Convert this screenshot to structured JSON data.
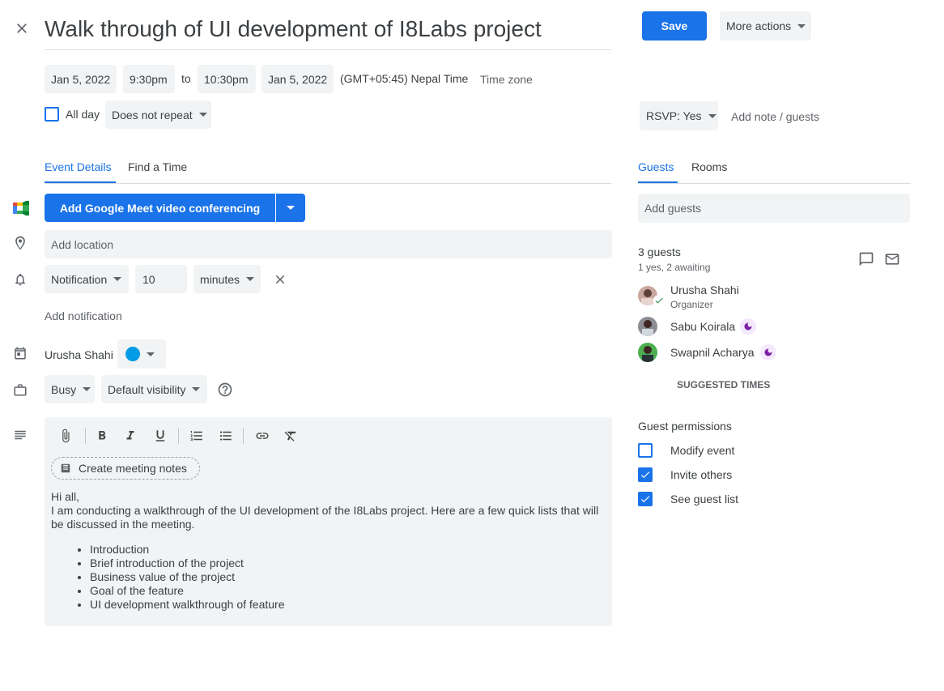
{
  "header": {
    "close_label": "×",
    "title": "Walk through of UI development of I8Labs project",
    "save_label": "Save",
    "more_actions_label": "More actions"
  },
  "datetime": {
    "start_date": "Jan 5, 2022",
    "start_time": "9:30pm",
    "to_label": "to",
    "end_time": "10:30pm",
    "end_date": "Jan 5, 2022",
    "timezone_text": "(GMT+05:45) Nepal Time",
    "timezone_link": "Time zone",
    "all_day_label": "All day",
    "repeat_value": "Does not repeat"
  },
  "rsvp": {
    "value": "RSVP: Yes",
    "add_note_label": "Add note / guests"
  },
  "left_tabs": [
    {
      "label": "Event Details"
    },
    {
      "label": "Find a Time"
    }
  ],
  "right_tabs": [
    {
      "label": "Guests"
    },
    {
      "label": "Rooms"
    }
  ],
  "event": {
    "meet_button_label": "Add Google Meet video conferencing",
    "location_placeholder": "Add location",
    "notification": {
      "type": "Notification",
      "amount": "10",
      "unit": "minutes",
      "add_label": "Add notification"
    },
    "calendar_owner": "Urusha Shahi",
    "calendar_color": "#039be5",
    "busy_value": "Busy",
    "visibility_value": "Default visibility",
    "create_notes_label": "Create meeting notes",
    "description": {
      "line1": "Hi all,",
      "line2": "I am conducting a walkthrough of the UI development of the I8Labs project. Here are a few quick lists that will be discussed in the meeting.",
      "items": [
        "Introduction",
        "Brief introduction of the project",
        "Business value of the project",
        "Goal of the feature",
        "UI development walkthrough of feature"
      ]
    }
  },
  "guests": {
    "add_placeholder": "Add guests",
    "count_label": "3 guests",
    "status_label": "1 yes, 2 awaiting",
    "list": [
      {
        "name": "Urusha Shahi",
        "role": "Organizer"
      },
      {
        "name": "Sabu Koirala",
        "role": ""
      },
      {
        "name": "Swapnil Acharya",
        "role": ""
      }
    ],
    "suggested_times_label": "SUGGESTED TIMES",
    "permissions_title": "Guest permissions",
    "permissions": [
      {
        "label": "Modify event",
        "checked": false
      },
      {
        "label": "Invite others",
        "checked": true
      },
      {
        "label": "See guest list",
        "checked": true
      }
    ]
  },
  "colors": {
    "accent": "#1a73e8",
    "chip_bg": "#f1f3f4",
    "text": "#3c4043",
    "moon_purple": "#7b1fa2"
  },
  "icons": {
    "close": "close-icon",
    "meet": "google-meet-icon",
    "location": "location-pin-icon",
    "notification": "bell-icon",
    "calendar": "calendar-icon",
    "busy": "briefcase-icon",
    "description": "notes-lines-icon",
    "help": "help-circle-icon"
  }
}
